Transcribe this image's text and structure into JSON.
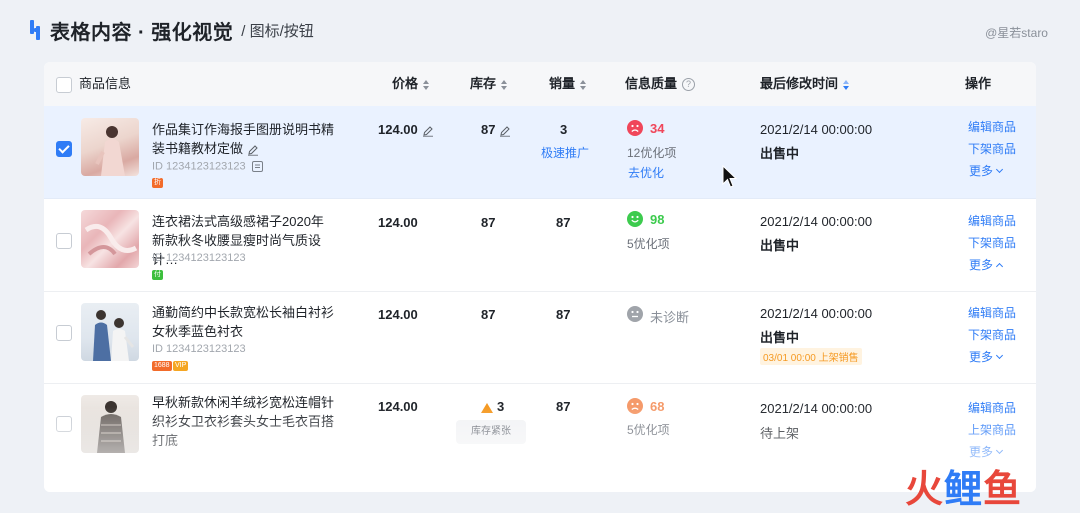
{
  "header": {
    "title": "表格内容 · 强化视觉",
    "subtitle": "/ 图标/按钮",
    "credit": "@星若staro"
  },
  "table": {
    "columns": {
      "product": "商品信息",
      "price": "价格",
      "stock": "库存",
      "sales": "销量",
      "quality": "信息质量",
      "modified": "最后修改时间",
      "actions": "操作"
    },
    "rows": [
      {
        "selected": true,
        "title": "作品集订作海报手图册说明书精装书籍教材定做",
        "id": "ID 1234123123123",
        "tags": [
          "折"
        ],
        "price": "124.00",
        "stock": "87",
        "sales": "3",
        "sales_link": "极速推广",
        "quality_score": "34",
        "quality_status": "sad",
        "quality_sub": "12优化项",
        "quality_link": "去优化",
        "time": "2021/2/14 00:00:00",
        "status": "出售中",
        "op_edit": "编辑商品",
        "op_off": "下架商品",
        "op_more": "更多"
      },
      {
        "selected": false,
        "title": "连衣裙法式高级感裙子2020年新款秋冬收腰显瘦时尚气质设计…",
        "id": "ID 1234123123123",
        "tags": [
          "付"
        ],
        "price": "124.00",
        "stock": "87",
        "sales": "87",
        "quality_score": "98",
        "quality_status": "happy",
        "quality_sub": "5优化项",
        "time": "2021/2/14 00:00:00",
        "status": "出售中",
        "op_edit": "编辑商品",
        "op_off": "下架商品",
        "op_more": "更多"
      },
      {
        "selected": false,
        "title": "通勤简约中长款宽松长袖白衬衫女秋季蓝色衬衣",
        "id": "ID 1234123123123",
        "tags": [
          "1688",
          "VIP"
        ],
        "price": "124.00",
        "stock": "87",
        "sales": "87",
        "quality_score": "未诊断",
        "quality_status": "neutral",
        "time": "2021/2/14 00:00:00",
        "status": "出售中",
        "note": "03/01 00:00 上架销售",
        "op_edit": "编辑商品",
        "op_off": "下架商品",
        "op_more": "更多"
      },
      {
        "selected": false,
        "title": "早秋新款休闲羊绒衫宽松连帽针织衫女卫衣衫套头女士毛衣百搭打底",
        "id": "",
        "tags": [],
        "price": "124.00",
        "stock": "3",
        "stock_tooltip": "库存紧张",
        "sales": "87",
        "quality_score": "68",
        "quality_status": "worried",
        "quality_sub": "5优化项",
        "time": "2021/2/14 00:00:00",
        "status": "待上架",
        "op_edit": "编辑商品",
        "op_off": "上架商品",
        "op_more": "更多"
      }
    ]
  },
  "watermark": [
    "火",
    "鲤",
    "鱼"
  ],
  "colors": {
    "accent": "#2f7cf6",
    "danger": "#f0465a",
    "success": "#3dcb4e",
    "warning": "#f59a23",
    "neutral": "#a0a4aa"
  }
}
